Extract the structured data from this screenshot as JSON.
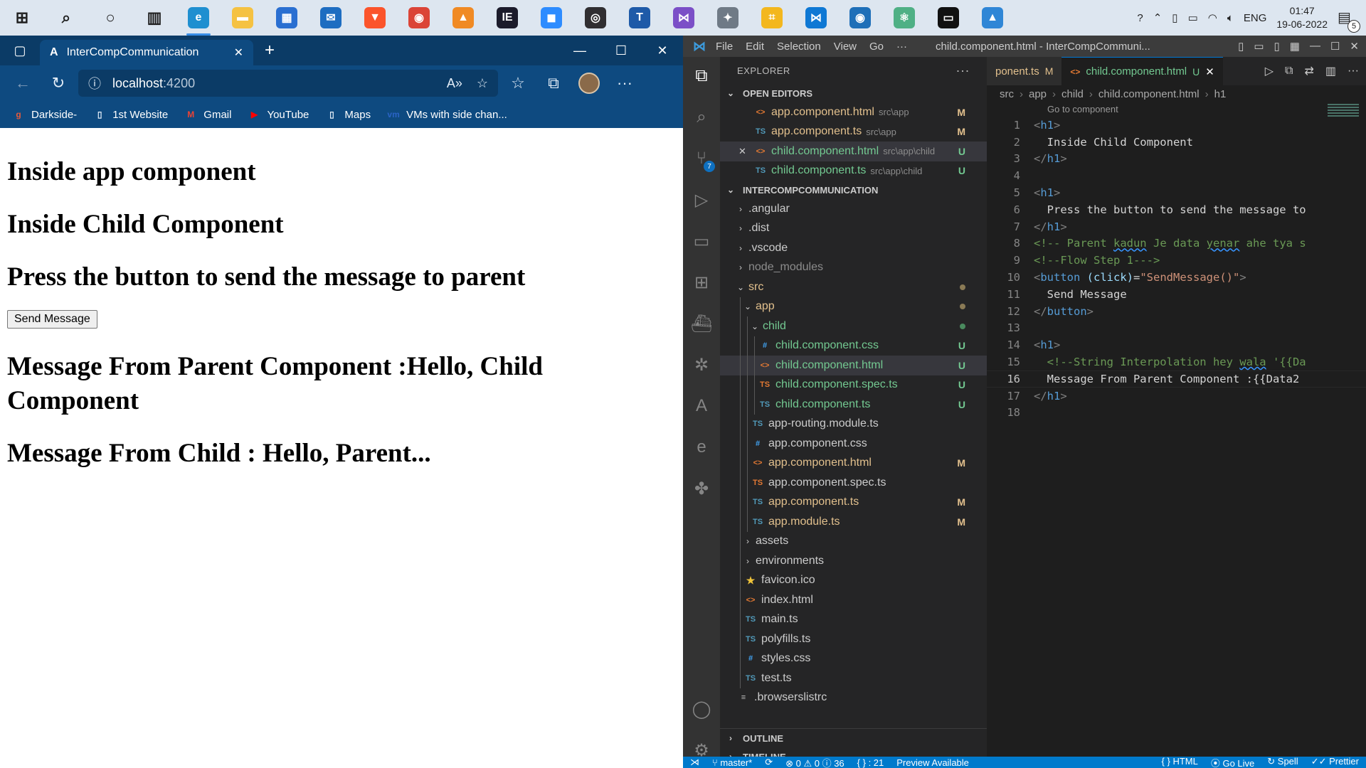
{
  "taskbar": {
    "apps": [
      {
        "name": "start-icon",
        "glyph": "⊞",
        "bg": "",
        "color": "#1e1e1e"
      },
      {
        "name": "search-icon",
        "glyph": "⌕",
        "bg": "",
        "color": "#1e1e1e"
      },
      {
        "name": "cortana-icon",
        "glyph": "○",
        "bg": "",
        "color": "#1e1e1e"
      },
      {
        "name": "task-view-icon",
        "glyph": "▥",
        "bg": "",
        "color": "#1e1e1e"
      },
      {
        "name": "edge-icon",
        "glyph": "e",
        "bg": "#1f8fd0",
        "color": "#fff",
        "active": true
      },
      {
        "name": "file-explorer-icon",
        "glyph": "▬",
        "bg": "#f5c242",
        "color": "#fff"
      },
      {
        "name": "store-icon",
        "glyph": "▦",
        "bg": "#2a6fd1",
        "color": "#fff"
      },
      {
        "name": "mail-icon",
        "glyph": "✉",
        "bg": "#1d6dc1",
        "color": "#fff"
      },
      {
        "name": "brave-icon",
        "glyph": "▼",
        "bg": "#fb542b",
        "color": "#fff"
      },
      {
        "name": "chrome-icon",
        "glyph": "◉",
        "bg": "#db4437",
        "color": "#fff"
      },
      {
        "name": "vlc-icon",
        "glyph": "▲",
        "bg": "#f08a24",
        "color": "#fff"
      },
      {
        "name": "intellij-icon",
        "glyph": "IE",
        "bg": "#1b1b2b",
        "color": "#fff"
      },
      {
        "name": "zoom-icon",
        "glyph": "◼",
        "bg": "#2d8cff",
        "color": "#fff"
      },
      {
        "name": "obs-icon",
        "glyph": "◎",
        "bg": "#302e31",
        "color": "#fff"
      },
      {
        "name": "app-t-icon",
        "glyph": "T",
        "bg": "#1e5aa8",
        "color": "#fff"
      },
      {
        "name": "visual-studio-icon",
        "glyph": "⋈",
        "bg": "#7b4fc7",
        "color": "#fff"
      },
      {
        "name": "settings-app-icon",
        "glyph": "✦",
        "bg": "#6f7a86",
        "color": "#fff"
      },
      {
        "name": "app-yellow-icon",
        "glyph": "⌗",
        "bg": "#f3b71e",
        "color": "#fff"
      },
      {
        "name": "vscode-icon",
        "glyph": "⋈",
        "bg": "#0e78d4",
        "color": "#fff"
      },
      {
        "name": "app-circle-icon",
        "glyph": "◉",
        "bg": "#1e6fb8",
        "color": "#fff"
      },
      {
        "name": "atom-icon",
        "glyph": "⚛",
        "bg": "#4fb085",
        "color": "#fff"
      },
      {
        "name": "terminal-icon",
        "glyph": "▭",
        "bg": "#111",
        "color": "#fff"
      },
      {
        "name": "photos-icon",
        "glyph": "▲",
        "bg": "#2f86d6",
        "color": "#fff"
      }
    ],
    "tray": {
      "language": "ENG",
      "time": "01:47",
      "date": "19-06-2022",
      "notifications": "5"
    }
  },
  "browser": {
    "tab_title": "InterCompCommunication",
    "address_host": "localhost",
    "address_port": ":4200",
    "bookmarks": [
      {
        "label": "Darkside-",
        "icon": "g",
        "color": "#e45a3c"
      },
      {
        "label": "1st Website",
        "icon": "▯",
        "color": "#e4eef8"
      },
      {
        "label": "Gmail",
        "icon": "M",
        "color": "#ea4335"
      },
      {
        "label": "YouTube",
        "icon": "▶",
        "color": "#ff0000"
      },
      {
        "label": "Maps",
        "icon": "▯",
        "color": "#e4eef8"
      },
      {
        "label": "VMs with side chan...",
        "icon": "vm",
        "color": "#2a63c4"
      }
    ],
    "page": {
      "h_app": "Inside app component",
      "h_child": "Inside Child Component",
      "h_press": "Press the button to send the message to parent",
      "send_button": "Send Message",
      "h_from_parent": "Message From Parent Component :Hello, Child Component",
      "h_from_child": "Message From Child : Hello, Parent..."
    }
  },
  "vscode": {
    "menu": [
      "File",
      "Edit",
      "Selection",
      "View",
      "Go",
      "···"
    ],
    "window_title": "child.component.html - InterCompCommuni...",
    "sidebar": {
      "title": "EXPLORER",
      "open_editors_label": "OPEN EDITORS",
      "project_label": "INTERCOMPCOMMUNICATION",
      "outline_label": "OUTLINE",
      "timeline_label": "TIMELINE",
      "open_editors": [
        {
          "icon": "<>",
          "kind": "html",
          "name": "app.component.html",
          "path": "src\\app",
          "status": "M",
          "state": "mod"
        },
        {
          "icon": "TS",
          "kind": "ts",
          "name": "app.component.ts",
          "path": "src\\app",
          "status": "M",
          "state": "mod"
        },
        {
          "icon": "<>",
          "kind": "html",
          "name": "child.component.html",
          "path": "src\\app\\child",
          "status": "U",
          "state": "untracked",
          "selected": true,
          "close": "✕"
        },
        {
          "icon": "TS",
          "kind": "ts",
          "name": "child.component.ts",
          "path": "src\\app\\child",
          "status": "U",
          "state": "untracked"
        }
      ],
      "tree": [
        {
          "depth": 0,
          "chev": "›",
          "name": ".angular",
          "state": ""
        },
        {
          "depth": 0,
          "chev": "›",
          "name": ".dist",
          "state": ""
        },
        {
          "depth": 0,
          "chev": "›",
          "name": ".vscode",
          "state": ""
        },
        {
          "depth": 0,
          "chev": "›",
          "name": "node_modules",
          "state": "ignored"
        },
        {
          "depth": 0,
          "chev": "⌄",
          "name": "src",
          "state": "mod",
          "dot": "#8a7a55"
        },
        {
          "depth": 1,
          "chev": "⌄",
          "name": "app",
          "state": "mod",
          "dot": "#8a7a55"
        },
        {
          "depth": 2,
          "chev": "⌄",
          "name": "child",
          "state": "untracked",
          "dot": "#4a8a5e"
        },
        {
          "depth": 3,
          "icon": "#",
          "kind": "css",
          "name": "child.component.css",
          "state": "untracked",
          "status": "U"
        },
        {
          "depth": 3,
          "icon": "<>",
          "kind": "html",
          "name": "child.component.html",
          "state": "untracked",
          "status": "U",
          "selected": true
        },
        {
          "depth": 3,
          "icon": "TS",
          "kind": "html",
          "name": "child.component.spec.ts",
          "state": "untracked",
          "status": "U"
        },
        {
          "depth": 3,
          "icon": "TS",
          "kind": "ts",
          "name": "child.component.ts",
          "state": "untracked",
          "status": "U"
        },
        {
          "depth": 2,
          "icon": "TS",
          "kind": "ts",
          "name": "app-routing.module.ts",
          "state": ""
        },
        {
          "depth": 2,
          "icon": "#",
          "kind": "css",
          "name": "app.component.css",
          "state": ""
        },
        {
          "depth": 2,
          "icon": "<>",
          "kind": "html",
          "name": "app.component.html",
          "state": "mod",
          "status": "M"
        },
        {
          "depth": 2,
          "icon": "TS",
          "kind": "html",
          "name": "app.component.spec.ts",
          "state": ""
        },
        {
          "depth": 2,
          "icon": "TS",
          "kind": "ts",
          "name": "app.component.ts",
          "state": "mod",
          "status": "M"
        },
        {
          "depth": 2,
          "icon": "TS",
          "kind": "ts",
          "name": "app.module.ts",
          "state": "mod",
          "status": "M"
        },
        {
          "depth": 1,
          "chev": "›",
          "name": "assets",
          "state": ""
        },
        {
          "depth": 1,
          "chev": "›",
          "name": "environments",
          "state": ""
        },
        {
          "depth": 1,
          "icon": "★",
          "kind": "star",
          "name": "favicon.ico",
          "state": ""
        },
        {
          "depth": 1,
          "icon": "<>",
          "kind": "html",
          "name": "index.html",
          "state": ""
        },
        {
          "depth": 1,
          "icon": "TS",
          "kind": "ts",
          "name": "main.ts",
          "state": ""
        },
        {
          "depth": 1,
          "icon": "TS",
          "kind": "ts",
          "name": "polyfills.ts",
          "state": ""
        },
        {
          "depth": 1,
          "icon": "#",
          "kind": "css",
          "name": "styles.css",
          "state": ""
        },
        {
          "depth": 1,
          "icon": "TS",
          "kind": "ts",
          "name": "test.ts",
          "state": ""
        },
        {
          "depth": 0,
          "icon": "≡",
          "kind": "list",
          "name": ".browserslistrc",
          "state": ""
        }
      ]
    },
    "editor": {
      "tabs": [
        {
          "label": "ponent.ts",
          "status": "M",
          "active": false
        },
        {
          "label": "child.component.html",
          "status": "U",
          "active": true,
          "icon": "<>",
          "close": "✕"
        }
      ],
      "breadcrumb": [
        "src",
        "app",
        "child",
        "child.component.html",
        "h1"
      ],
      "codelens": "Go to component",
      "current_line": 16,
      "lines": [
        [
          {
            "t": "<",
            "c": "pun"
          },
          {
            "t": "h1",
            "c": "tag"
          },
          {
            "t": ">",
            "c": "pun"
          }
        ],
        [
          {
            "t": "  Inside Child Component",
            "c": "ct"
          }
        ],
        [
          {
            "t": "</",
            "c": "pun"
          },
          {
            "t": "h1",
            "c": "tag"
          },
          {
            "t": ">",
            "c": "pun"
          }
        ],
        [],
        [
          {
            "t": "<",
            "c": "pun"
          },
          {
            "t": "h1",
            "c": "tag"
          },
          {
            "t": ">",
            "c": "pun"
          }
        ],
        [
          {
            "t": "  Press the button to send the message to",
            "c": "ct"
          }
        ],
        [
          {
            "t": "</",
            "c": "pun"
          },
          {
            "t": "h1",
            "c": "tag"
          },
          {
            "t": ">",
            "c": "pun"
          }
        ],
        [
          {
            "t": "<!-- Parent ",
            "c": "cmt"
          },
          {
            "t": "kadun",
            "c": "cmt sq"
          },
          {
            "t": " Je data ",
            "c": "cmt"
          },
          {
            "t": "yenar",
            "c": "cmt sq"
          },
          {
            "t": " ahe tya s",
            "c": "cmt"
          }
        ],
        [
          {
            "t": "<!--Flow Step 1--->",
            "c": "cmt"
          }
        ],
        [
          {
            "t": "<",
            "c": "pun"
          },
          {
            "t": "button",
            "c": "tag"
          },
          {
            "t": " (click)",
            "c": "attr"
          },
          {
            "t": "=",
            "c": "ct"
          },
          {
            "t": "\"SendMessage()\"",
            "c": "str"
          },
          {
            "t": ">",
            "c": "pun"
          }
        ],
        [
          {
            "t": "  Send Message",
            "c": "ct"
          }
        ],
        [
          {
            "t": "</",
            "c": "pun"
          },
          {
            "t": "button",
            "c": "tag"
          },
          {
            "t": ">",
            "c": "pun"
          }
        ],
        [],
        [
          {
            "t": "<",
            "c": "pun"
          },
          {
            "t": "h1",
            "c": "tag"
          },
          {
            "t": ">",
            "c": "pun"
          }
        ],
        [
          {
            "t": "  <!--String Interpolation hey ",
            "c": "cmt"
          },
          {
            "t": "wala",
            "c": "cmt sq"
          },
          {
            "t": " '{{Da",
            "c": "cmt"
          }
        ],
        [
          {
            "t": "  Message From Parent Component :{{Data2",
            "c": "ct"
          }
        ],
        [
          {
            "t": "</",
            "c": "pun"
          },
          {
            "t": "h1",
            "c": "tag"
          },
          {
            "t": ">",
            "c": "pun"
          }
        ],
        []
      ]
    },
    "status": {
      "branch": "master*",
      "problems": "⊗ 0 ⚠ 0 ⓘ 36",
      "position": "{ } : 21",
      "preview": "Preview Available",
      "right": [
        "{ } HTML",
        "⦿ Go Live",
        "↻ Spell",
        "✓✓ Prettier"
      ]
    }
  }
}
